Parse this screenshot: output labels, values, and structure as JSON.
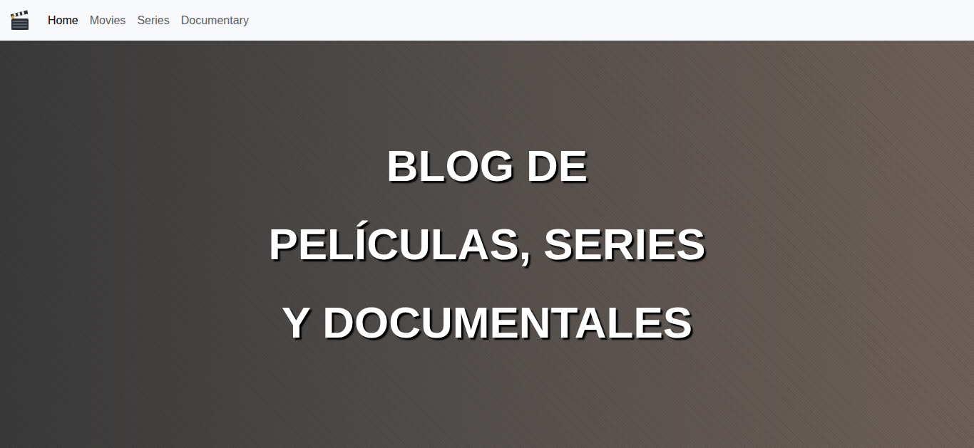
{
  "navbar": {
    "links": [
      {
        "label": "Home",
        "selected": true
      },
      {
        "label": "Movies",
        "selected": false
      },
      {
        "label": "Series",
        "selected": false
      },
      {
        "label": "Documentary",
        "selected": false
      }
    ]
  },
  "hero": {
    "title_lines": [
      "BLOG DE",
      "PELÍCULAS, SERIES",
      "Y DOCUMENTALES"
    ]
  }
}
